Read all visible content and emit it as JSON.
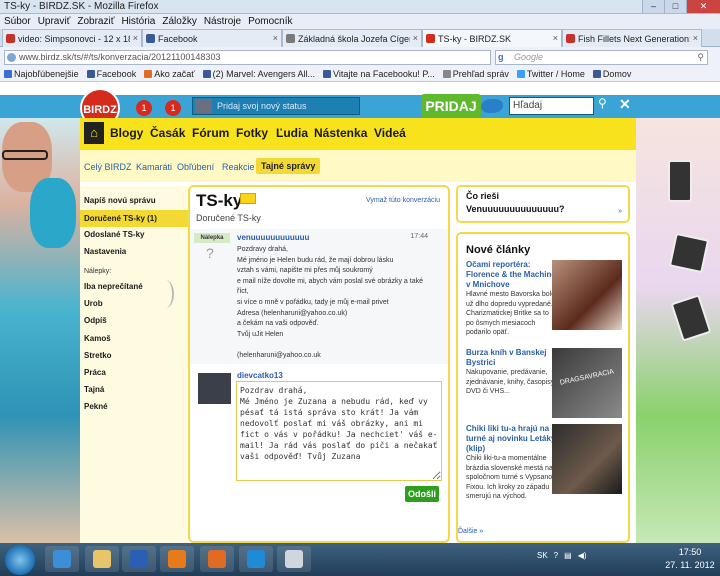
{
  "window": {
    "title": "TS-ky - BIRDZ.SK - Mozilla Firefox",
    "controls": [
      "–",
      "□",
      "✕"
    ]
  },
  "menu": [
    "Súbor",
    "Upraviť",
    "Zobraziť",
    "História",
    "Záložky",
    "Nástroje",
    "Pomocník"
  ],
  "tabs": [
    {
      "label": "video: Simpsonovci - 12 x 18",
      "color": "#c9302c"
    },
    {
      "label": "Facebook",
      "color": "#3b5998"
    },
    {
      "label": "Základná škola Jozefa Cígera ...",
      "color": "#7a7a7a"
    },
    {
      "label": "TS-ky - BIRDZ.SK",
      "color": "#d52b1e"
    },
    {
      "label": "Fish Fillets Next Generation: ...",
      "color": "#c9302c"
    }
  ],
  "address": {
    "url": "www.birdz.sk/ts/#/ts/konverzacia/20121100148303",
    "search_placeholder": "Google",
    "search_logo": "g"
  },
  "bookmarks": [
    {
      "label": "Najobľúbenejšie",
      "color": "#3a6fd8"
    },
    {
      "label": "Facebook",
      "color": "#3b5998"
    },
    {
      "label": "Ako začať",
      "color": "#e06b24"
    },
    {
      "label": "(2) Marvel: Avengers All...",
      "color": "#3b5998"
    },
    {
      "label": "Vitajte na Facebooku! P...",
      "color": "#3b5998"
    },
    {
      "label": "Prehľad správ",
      "color": "#888"
    },
    {
      "label": "Twitter / Home",
      "color": "#38a1f3"
    },
    {
      "label": "Domov",
      "color": "#3b5998"
    }
  ],
  "site": {
    "logo": "BIRDZ",
    "notif_count_1": "1",
    "notif_count_2": "1",
    "status_placeholder": "Pridaj svoj nový status",
    "post_button": "PRIDAJ",
    "search_value": "Hľadaj",
    "close": "✕",
    "nav": [
      "Blogy",
      "Časák",
      "Fórum",
      "Fotky",
      "Ľudia",
      "Nástenka",
      "Videá"
    ],
    "subnav": [
      "Celý BIRDZ",
      "Kamaráti",
      "Obľúbení",
      "Reakcie",
      "Tajné správy"
    ]
  },
  "leftmenu": {
    "items": [
      "Napíš novú správu",
      "Doručené TS-ky (1)",
      "Odoslané TS-ky",
      "Nastavenia"
    ],
    "labels_title": "Nálepky:",
    "labels": [
      "Iba neprečítané",
      "Urob",
      "Odpíš",
      "Kamoš",
      "Stretko",
      "Práca",
      "Tajná",
      "Pekné"
    ]
  },
  "conversation": {
    "title": "TS-ky",
    "delete_link": "Vymaž túto konverzáciu",
    "folder": "Doručené TS-ky",
    "msg1": {
      "tag": "Nálepka",
      "avatar_placeholder": "?",
      "sender": "venuuuuuuuuuuuu",
      "time": "17:44",
      "lines": [
        "Pozdravy drahá,",
        "Mé jméno je Helen budu rád, že mají dobrou lásku",
        "vztah s vámi, napište mi přes můj soukromý",
        "e mail níže dovolte mi, abych vám poslal své obrázky a také",
        "říct,",
        "si více o mně v pořádku, tady je můj e-mail privet",
        "Adresa (helenharuni@yahoo.co.uk)",
        "a čekám na vaši odpověď.",
        "Tvůj uJit Helen",
        "",
        "(helenharuni@yahoo.co.uk"
      ]
    },
    "msg2": {
      "sender": "dievcatko13",
      "reply_text": "Pozdrav drahá,\nMé Jméno je Zuzana a nebudu rád, keď vy pésať tá istá správa sto krát! Ja vám nedovolť poslať mi váš obrázky, ani mi fict o vás v pořádku! Ja nechciet' váš e-mail! Ja rád vás poslať do piči a nečakať vaši odpověď! Tvůj Zuzana",
      "send_label": "Odošli"
    }
  },
  "sidebar": {
    "what_title": "Čo rieši",
    "what_line2": "Venuuuuuuuuuuuuuu?",
    "what_more": "»",
    "articles_title": "Nové články",
    "articles": [
      {
        "title": "Očami reportéra: Florence & the Machine v Mnichove",
        "desc": "Hlavné mesto Bavorska bolo už dlho dopredu vypredané. Charizmatickej Britke sa to po ôsmych mesiacoch podarilo opäť."
      },
      {
        "title": "Burza kníh v Banskej Bystrici",
        "desc": "Nakupovanie, predávanie, zjednávanie, knihy, časopisy, DVD či VHS..."
      },
      {
        "title": "Chiki liki tu-a hrajú na turné aj novinku Letáky (klip)",
        "desc": "Chiki liki-tu-a momentálne brázdia slovenské mestá na spoločnom turné s Vypsanou Fixou. Ich kroky zo západu smerujú na východ."
      }
    ],
    "article_image_text": "DRAGSAVRACIA",
    "more": "Ďalšie »"
  },
  "taskbar": {
    "lang": "SK",
    "time": "17:50",
    "date": "27. 11. 2012"
  }
}
